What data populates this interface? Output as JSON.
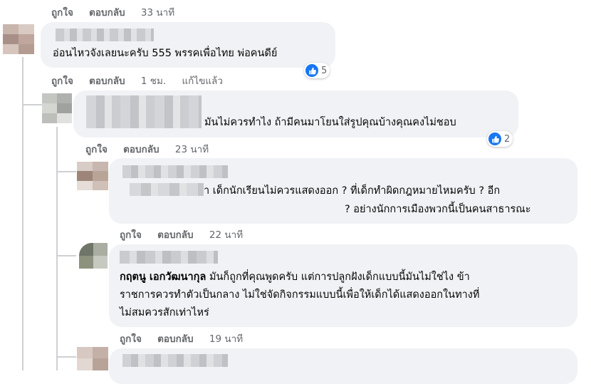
{
  "comments": [
    {
      "likeLabel": "ถูกใจ",
      "replyLabel": "ตอบกลับ",
      "time": "33 นาที"
    },
    {
      "text": "อ่อนไหวจังเลยนะครับ 555 พรรคเพื่อไทย พ่อคนดีย์",
      "likeLabel": "ถูกใจ",
      "replyLabel": "ตอบกลับ",
      "time": "1 ชม.",
      "edited": "แก้ไขแล้ว",
      "reactionCount": "5"
    },
    {
      "text": "มันไม่ควรทำไง ถ้ามีคนมาโยนใส่รูปคุณบ้างคุณคงไม่ชอบ",
      "likeLabel": "ถูกใจ",
      "replyLabel": "ตอบกลับ",
      "time": "23 นาที",
      "reactionCount": "2"
    },
    {
      "line1": "า เด็กนักเรียนไม่ควรแสดงออก ? ที่เด็กทำผิดกฎหมายไหมครับ ? อีก",
      "line2": "? อย่างนักการเมืองพวกนี้เป็นคนสาธารณะ",
      "likeLabel": "ถูกใจ",
      "replyLabel": "ตอบกลับ",
      "time": "22 นาที"
    },
    {
      "tagName": "กฤตนู เอกวัฒนากุล",
      "line1": " มันก็ถูกที่คุณพูดครับ แต่การปลูกฝังเด็กแบบนี้มันไม่ใช่ไง ข้า",
      "line2": "ราชการควรทำตัวเป็นกลาง ไม่ใช่จัดกิจกรรมแบบนี้เพื่อให้เด็กได้แสดงออกในทางที่",
      "line3": "ไม่สมควรสักเท่าไหร่",
      "likeLabel": "ถูกใจ",
      "replyLabel": "ตอบกลับ",
      "time": "19 นาที"
    }
  ],
  "colors": {
    "bubble": "#f0f2f5",
    "meta": "#65676b",
    "text": "#050505",
    "like": "#1877f2",
    "thread": "#ced0d4"
  },
  "icons": {
    "reaction": "like-thumb-icon",
    "avatar": "pixelated-avatar"
  }
}
